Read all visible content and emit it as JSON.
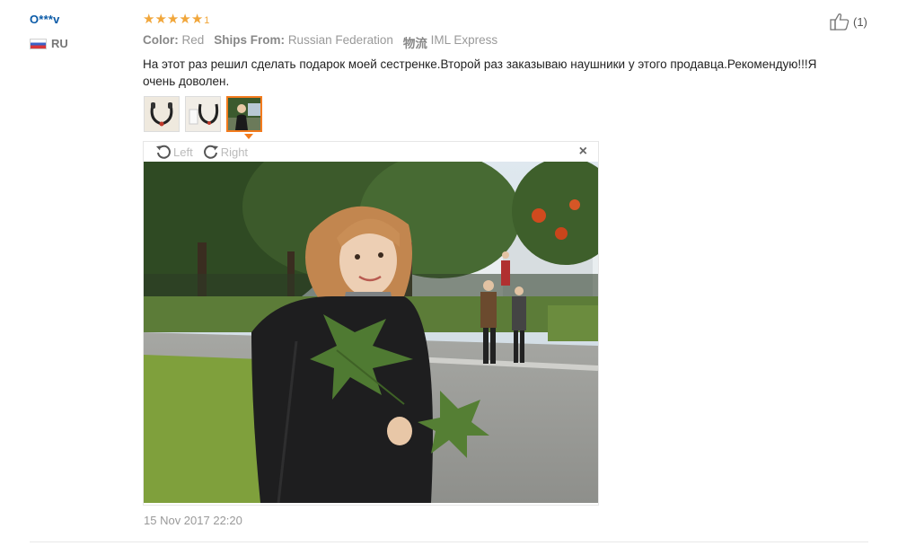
{
  "user": {
    "name": "O***v",
    "country_code": "RU"
  },
  "rating": {
    "stars": 5,
    "count_label": "1",
    "color": "#f1a63a"
  },
  "attributes": [
    {
      "key": "Color:",
      "value": "Red"
    },
    {
      "key": "Ships From:",
      "value": "Russian Federation"
    },
    {
      "key": "物流",
      "value": "IML Express"
    }
  ],
  "review_text": "На этот раз решил сделать подарок моей сестренке.Второй раз заказываю наушники у этого продавца.Рекомендую!!!Я очень доволен.",
  "thumbnails": [
    {
      "label": "photo-1",
      "active": false
    },
    {
      "label": "photo-2",
      "active": false
    },
    {
      "label": "photo-3",
      "active": true
    }
  ],
  "viewer": {
    "rotate_left_label": "Left",
    "rotate_right_label": "Right",
    "close_label": "×"
  },
  "date": "15 Nov 2017 22:20",
  "helpful": {
    "count_label": "(1)"
  },
  "colors": {
    "accent": "#f37b1d",
    "link": "#0a5aa7"
  }
}
